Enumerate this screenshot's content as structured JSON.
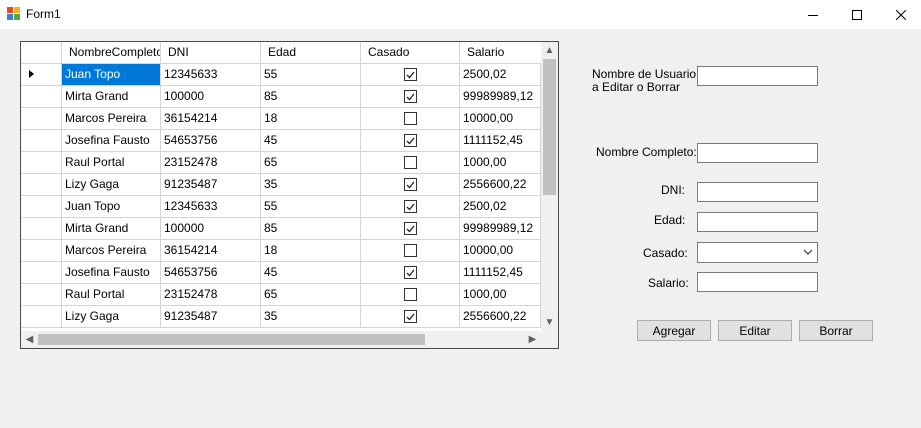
{
  "window": {
    "title": "Form1"
  },
  "grid": {
    "columns": [
      "NombreCompleto",
      "DNI",
      "Edad",
      "Casado",
      "Salario"
    ],
    "rows": [
      {
        "nombre": "Juan Topo",
        "dni": "12345633",
        "edad": "55",
        "casado": true,
        "salario": "2500,02"
      },
      {
        "nombre": "Mirta Grand",
        "dni": "100000",
        "edad": "85",
        "casado": true,
        "salario": "99989989,12"
      },
      {
        "nombre": "Marcos Pereira",
        "dni": "36154214",
        "edad": "18",
        "casado": false,
        "salario": "10000,00"
      },
      {
        "nombre": "Josefina Fausto",
        "dni": "54653756",
        "edad": "45",
        "casado": true,
        "salario": "1111152,45"
      },
      {
        "nombre": "Raul Portal",
        "dni": "23152478",
        "edad": "65",
        "casado": false,
        "salario": "1000,00"
      },
      {
        "nombre": "Lizy Gaga",
        "dni": "91235487",
        "edad": "35",
        "casado": true,
        "salario": "2556600,22"
      },
      {
        "nombre": "Juan Topo",
        "dni": "12345633",
        "edad": "55",
        "casado": true,
        "salario": "2500,02"
      },
      {
        "nombre": "Mirta Grand",
        "dni": "100000",
        "edad": "85",
        "casado": true,
        "salario": "99989989,12"
      },
      {
        "nombre": "Marcos Pereira",
        "dni": "36154214",
        "edad": "18",
        "casado": false,
        "salario": "10000,00"
      },
      {
        "nombre": "Josefina Fausto",
        "dni": "54653756",
        "edad": "45",
        "casado": true,
        "salario": "1111152,45"
      },
      {
        "nombre": "Raul Portal",
        "dni": "23152478",
        "edad": "65",
        "casado": false,
        "salario": "1000,00"
      },
      {
        "nombre": "Lizy Gaga",
        "dni": "91235487",
        "edad": "35",
        "casado": true,
        "salario": "2556600,22"
      }
    ],
    "selection_color": "#0078d7"
  },
  "form": {
    "usuario_label_line1": "Nombre de Usuario",
    "usuario_label_line2": "a Editar o Borrar",
    "usuario_value": "",
    "nombre_label": "Nombre Completo:",
    "nombre_value": "",
    "dni_label": "DNI:",
    "dni_value": "",
    "edad_label": "Edad:",
    "edad_value": "",
    "casado_label": "Casado:",
    "casado_value": "",
    "salario_label": "Salario:",
    "salario_value": ""
  },
  "buttons": {
    "agregar": "Agregar",
    "editar": "Editar",
    "borrar": "Borrar"
  },
  "icons": {
    "app": "form-app-icon",
    "minimize": "minimize-icon",
    "maximize": "maximize-icon",
    "close": "close-icon"
  }
}
